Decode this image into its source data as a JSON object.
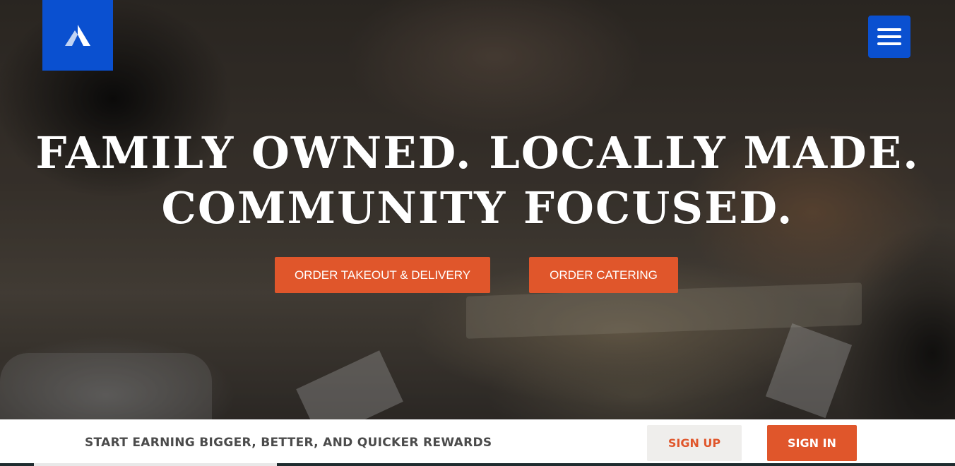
{
  "brand": {
    "logo_icon": "mountain-a-logo",
    "accent_color": "#0a50d0"
  },
  "nav": {
    "menu_icon": "hamburger-menu-icon"
  },
  "hero": {
    "headline_line1": "FAMILY OWNED. LOCALLY MADE.",
    "headline_line2": "COMMUNITY FOCUSED.",
    "cta_takeout": "ORDER TAKEOUT & DELIVERY",
    "cta_catering": "ORDER CATERING",
    "cta_color": "#e0562b"
  },
  "rewards": {
    "text": "START EARNING BIGGER, BETTER, AND QUICKER REWARDS",
    "sign_up": "SIGN UP",
    "sign_in": "SIGN IN"
  }
}
